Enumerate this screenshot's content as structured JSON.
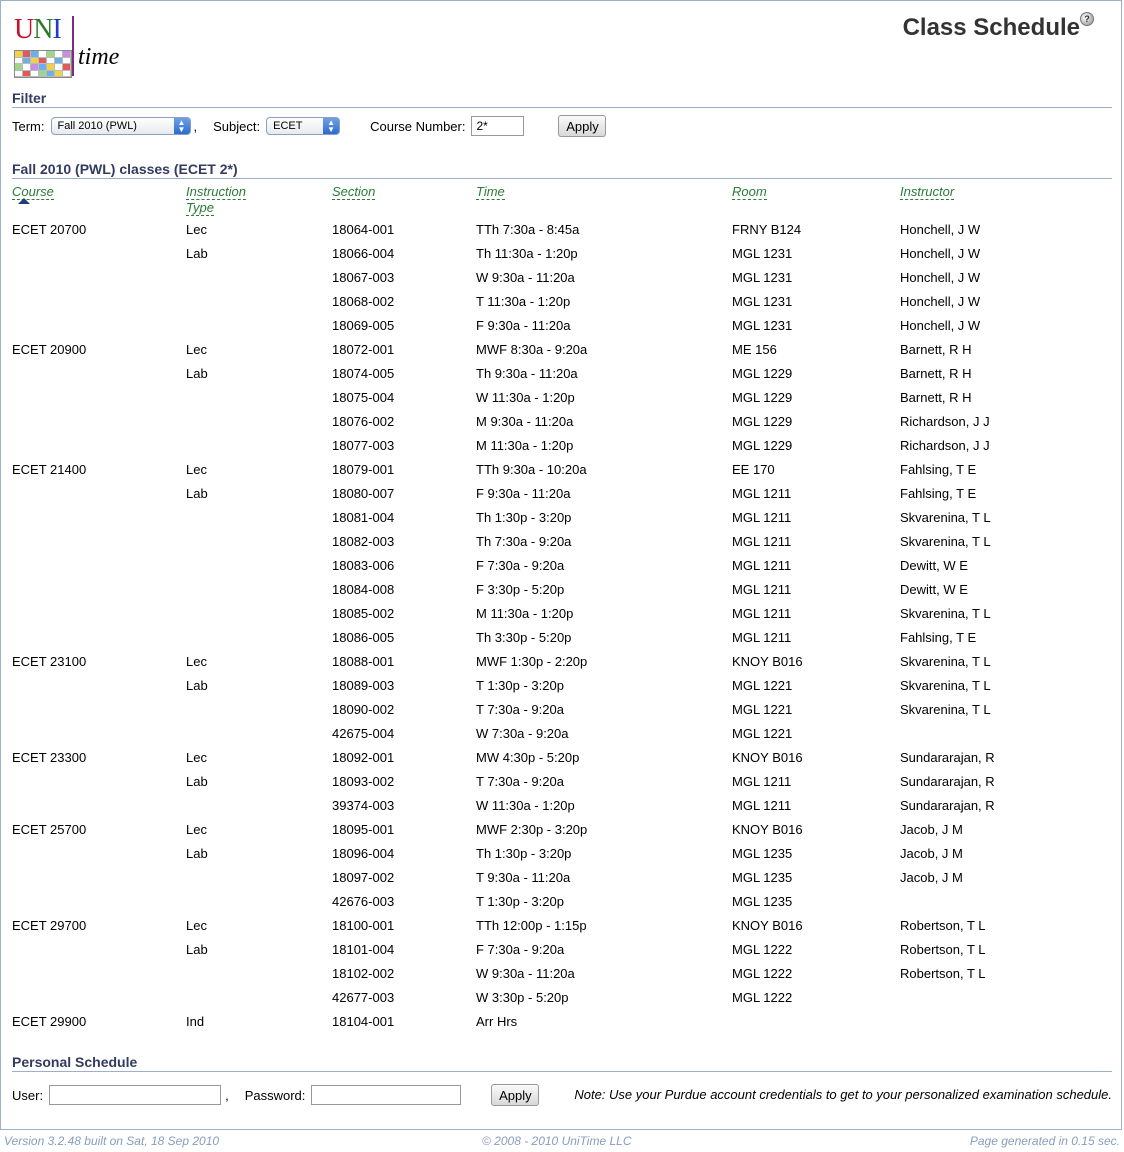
{
  "header": {
    "logo_text": "UNI time",
    "title": "Class Schedule",
    "help_icon": "?"
  },
  "filter": {
    "section_title": "Filter",
    "term_label": "Term:",
    "term_value": "Fall 2010 (PWL)",
    "separator": ",",
    "subject_label": "Subject:",
    "subject_value": "ECET",
    "course_number_label": "Course Number:",
    "course_number_value": "2*",
    "apply_label": "Apply"
  },
  "classes": {
    "section_title": "Fall 2010 (PWL) classes (ECET 2*)",
    "columns": {
      "course": "Course",
      "instruction_type_1": "Instruction",
      "instruction_type_2": "Type",
      "section": "Section",
      "time": "Time",
      "room": "Room",
      "instructor": "Instructor"
    },
    "rows": [
      {
        "course": "ECET 20700",
        "type": "Lec",
        "section": "18064-001",
        "time": "TTh 7:30a - 8:45a",
        "room": "FRNY B124",
        "instructor": "Honchell, J W"
      },
      {
        "course": "",
        "type": "Lab",
        "section": "18066-004",
        "time": "Th 11:30a - 1:20p",
        "room": "MGL 1231",
        "instructor": "Honchell, J W"
      },
      {
        "course": "",
        "type": "",
        "section": "18067-003",
        "time": "W 9:30a - 11:20a",
        "room": "MGL 1231",
        "instructor": "Honchell, J W"
      },
      {
        "course": "",
        "type": "",
        "section": "18068-002",
        "time": "T 11:30a - 1:20p",
        "room": "MGL 1231",
        "instructor": "Honchell, J W"
      },
      {
        "course": "",
        "type": "",
        "section": "18069-005",
        "time": "F 9:30a - 11:20a",
        "room": "MGL 1231",
        "instructor": "Honchell, J W"
      },
      {
        "course": "ECET 20900",
        "type": "Lec",
        "section": "18072-001",
        "time": "MWF 8:30a - 9:20a",
        "room": "ME 156",
        "instructor": "Barnett, R H"
      },
      {
        "course": "",
        "type": "Lab",
        "section": "18074-005",
        "time": "Th 9:30a - 11:20a",
        "room": "MGL 1229",
        "instructor": "Barnett, R H"
      },
      {
        "course": "",
        "type": "",
        "section": "18075-004",
        "time": "W 11:30a - 1:20p",
        "room": "MGL 1229",
        "instructor": "Barnett, R H"
      },
      {
        "course": "",
        "type": "",
        "section": "18076-002",
        "time": "M 9:30a - 11:20a",
        "room": "MGL 1229",
        "instructor": "Richardson, J J"
      },
      {
        "course": "",
        "type": "",
        "section": "18077-003",
        "time": "M 11:30a - 1:20p",
        "room": "MGL 1229",
        "instructor": "Richardson, J J"
      },
      {
        "course": "ECET 21400",
        "type": "Lec",
        "section": "18079-001",
        "time": "TTh 9:30a - 10:20a",
        "room": "EE 170",
        "instructor": "Fahlsing, T E"
      },
      {
        "course": "",
        "type": "Lab",
        "section": "18080-007",
        "time": "F 9:30a - 11:20a",
        "room": "MGL 1211",
        "instructor": "Fahlsing, T E"
      },
      {
        "course": "",
        "type": "",
        "section": "18081-004",
        "time": "Th 1:30p - 3:20p",
        "room": "MGL 1211",
        "instructor": "Skvarenina, T L"
      },
      {
        "course": "",
        "type": "",
        "section": "18082-003",
        "time": "Th 7:30a - 9:20a",
        "room": "MGL 1211",
        "instructor": "Skvarenina, T L"
      },
      {
        "course": "",
        "type": "",
        "section": "18083-006",
        "time": "F 7:30a - 9:20a",
        "room": "MGL 1211",
        "instructor": "Dewitt, W E"
      },
      {
        "course": "",
        "type": "",
        "section": "18084-008",
        "time": "F 3:30p - 5:20p",
        "room": "MGL 1211",
        "instructor": "Dewitt, W E"
      },
      {
        "course": "",
        "type": "",
        "section": "18085-002",
        "time": "M 11:30a - 1:20p",
        "room": "MGL 1211",
        "instructor": "Skvarenina, T L"
      },
      {
        "course": "",
        "type": "",
        "section": "18086-005",
        "time": "Th 3:30p - 5:20p",
        "room": "MGL 1211",
        "instructor": "Fahlsing, T E"
      },
      {
        "course": "ECET 23100",
        "type": "Lec",
        "section": "18088-001",
        "time": "MWF 1:30p - 2:20p",
        "room": "KNOY B016",
        "instructor": "Skvarenina, T L"
      },
      {
        "course": "",
        "type": "Lab",
        "section": "18089-003",
        "time": "T 1:30p - 3:20p",
        "room": "MGL 1221",
        "instructor": "Skvarenina, T L"
      },
      {
        "course": "",
        "type": "",
        "section": "18090-002",
        "time": "T 7:30a - 9:20a",
        "room": "MGL 1221",
        "instructor": "Skvarenina, T L"
      },
      {
        "course": "",
        "type": "",
        "section": "42675-004",
        "time": "W 7:30a - 9:20a",
        "room": "MGL 1221",
        "instructor": ""
      },
      {
        "course": "ECET 23300",
        "type": "Lec",
        "section": "18092-001",
        "time": "MW 4:30p - 5:20p",
        "room": "KNOY B016",
        "instructor": "Sundararajan, R"
      },
      {
        "course": "",
        "type": "Lab",
        "section": "18093-002",
        "time": "T 7:30a - 9:20a",
        "room": "MGL 1211",
        "instructor": "Sundararajan, R"
      },
      {
        "course": "",
        "type": "",
        "section": "39374-003",
        "time": "W 11:30a - 1:20p",
        "room": "MGL 1211",
        "instructor": "Sundararajan, R"
      },
      {
        "course": "ECET 25700",
        "type": "Lec",
        "section": "18095-001",
        "time": "MWF 2:30p - 3:20p",
        "room": "KNOY B016",
        "instructor": "Jacob, J M"
      },
      {
        "course": "",
        "type": "Lab",
        "section": "18096-004",
        "time": "Th 1:30p - 3:20p",
        "room": "MGL 1235",
        "instructor": "Jacob, J M"
      },
      {
        "course": "",
        "type": "",
        "section": "18097-002",
        "time": "T 9:30a - 11:20a",
        "room": "MGL 1235",
        "instructor": "Jacob, J M"
      },
      {
        "course": "",
        "type": "",
        "section": "42676-003",
        "time": "T 1:30p - 3:20p",
        "room": "MGL 1235",
        "instructor": ""
      },
      {
        "course": "ECET 29700",
        "type": "Lec",
        "section": "18100-001",
        "time": "TTh 12:00p - 1:15p",
        "room": "KNOY B016",
        "instructor": "Robertson, T L"
      },
      {
        "course": "",
        "type": "Lab",
        "section": "18101-004",
        "time": "F 7:30a - 9:20a",
        "room": "MGL 1222",
        "instructor": "Robertson, T L"
      },
      {
        "course": "",
        "type": "",
        "section": "18102-002",
        "time": "W 9:30a - 11:20a",
        "room": "MGL 1222",
        "instructor": "Robertson, T L"
      },
      {
        "course": "",
        "type": "",
        "section": "42677-003",
        "time": "W 3:30p - 5:20p",
        "room": "MGL 1222",
        "instructor": ""
      },
      {
        "course": "ECET 29900",
        "type": "Ind",
        "section": "18104-001",
        "time": "Arr Hrs",
        "room": "",
        "instructor": ""
      }
    ]
  },
  "personal": {
    "section_title": "Personal Schedule",
    "user_label": "User:",
    "user_value": "",
    "separator": ",",
    "password_label": "Password:",
    "password_value": "",
    "apply_label": "Apply",
    "note": "Note: Use your Purdue account credentials to get to your personalized examination schedule."
  },
  "footer": {
    "version": "Version 3.2.48 built on Sat, 18 Sep 2010",
    "copyright": "© 2008 - 2010 UniTime LLC",
    "generated": "Page generated in 0.15 sec."
  },
  "colors": {
    "header_text": "#333b60",
    "column_header": "#2b7a3a",
    "footer_text": "#8a9cbc",
    "rule": "#9cb0ce"
  }
}
